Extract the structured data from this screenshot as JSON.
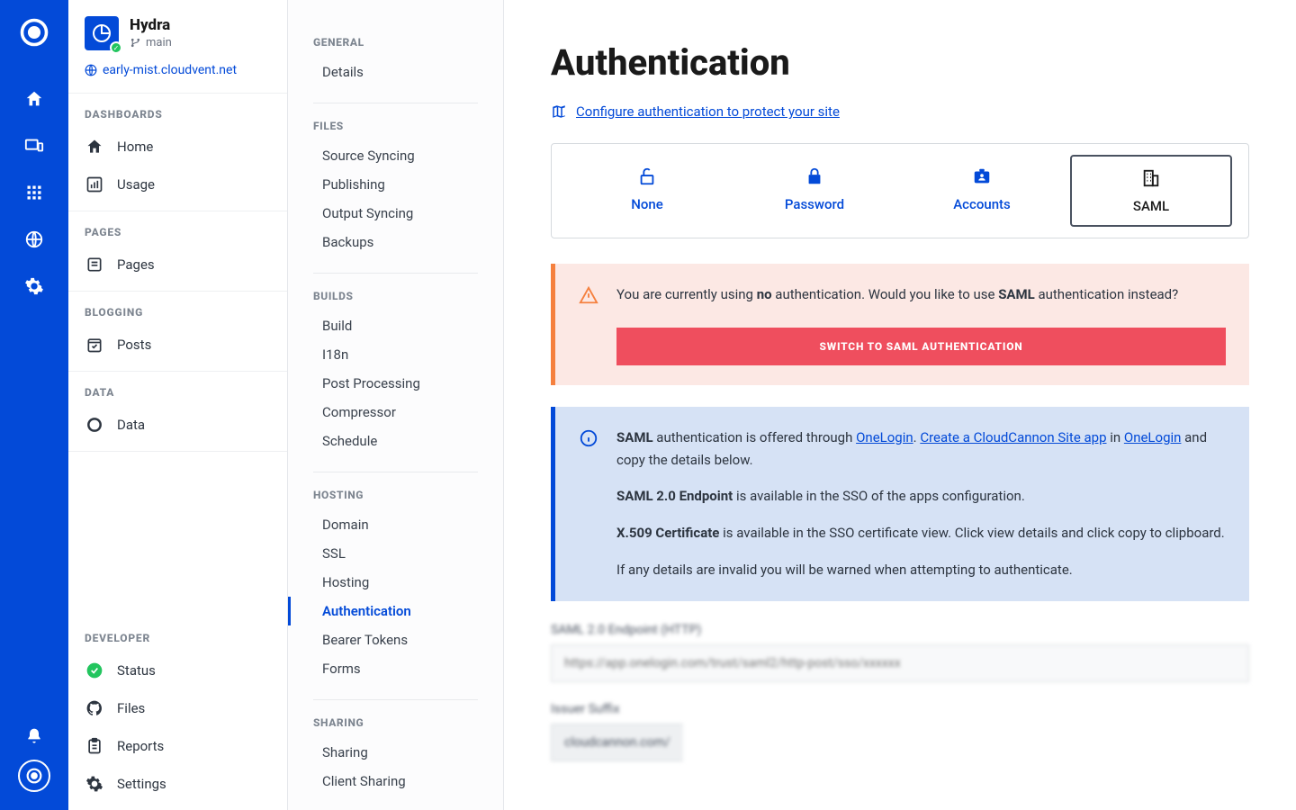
{
  "site": {
    "name": "Hydra",
    "branch": "main",
    "url": "early-mist.cloudvent.net"
  },
  "sidebar": {
    "sections": [
      {
        "heading": "DASHBOARDS",
        "items": [
          {
            "label": "Home"
          },
          {
            "label": "Usage"
          }
        ]
      },
      {
        "heading": "PAGES",
        "items": [
          {
            "label": "Pages"
          }
        ]
      },
      {
        "heading": "BLOGGING",
        "items": [
          {
            "label": "Posts"
          }
        ]
      },
      {
        "heading": "DATA",
        "items": [
          {
            "label": "Data"
          }
        ]
      }
    ],
    "dev": {
      "heading": "DEVELOPER",
      "items": [
        {
          "label": "Status"
        },
        {
          "label": "Files"
        },
        {
          "label": "Reports"
        },
        {
          "label": "Settings"
        }
      ]
    }
  },
  "settings_nav": {
    "groups": [
      {
        "heading": "GENERAL",
        "items": [
          "Details"
        ]
      },
      {
        "heading": "FILES",
        "items": [
          "Source Syncing",
          "Publishing",
          "Output Syncing",
          "Backups"
        ]
      },
      {
        "heading": "BUILDS",
        "items": [
          "Build",
          "I18n",
          "Post Processing",
          "Compressor",
          "Schedule"
        ]
      },
      {
        "heading": "HOSTING",
        "items": [
          "Domain",
          "SSL",
          "Hosting",
          "Authentication",
          "Bearer Tokens",
          "Forms"
        ]
      },
      {
        "heading": "SHARING",
        "items": [
          "Sharing",
          "Client Sharing"
        ]
      }
    ],
    "active": "Authentication"
  },
  "main": {
    "title": "Authentication",
    "doc_link": "Configure authentication to protect your site",
    "tabs": [
      {
        "label": "None"
      },
      {
        "label": "Password"
      },
      {
        "label": "Accounts"
      },
      {
        "label": "SAML"
      }
    ],
    "active_tab": "SAML",
    "warn": {
      "text_pre": "You are currently using ",
      "text_bold1": "no",
      "text_mid": " authentication. Would you like to use ",
      "text_bold2": "SAML",
      "text_post": " authentication instead?",
      "button": "SWITCH TO SAML AUTHENTICATION"
    },
    "info": {
      "p1_bold": "SAML",
      "p1_a": " authentication is offered through ",
      "p1_link1": "OneLogin",
      "p1_b": ". ",
      "p1_link2": "Create a CloudCannon Site app",
      "p1_c": " in ",
      "p1_link3": "OneLogin",
      "p1_d": " and copy the details below.",
      "p2_bold": "SAML 2.0 Endpoint",
      "p2_rest": " is available in the SSO of the apps configuration.",
      "p3_bold": "X.509 Certificate",
      "p3_rest": " is available in the SSO certificate view. Click view details and click copy to clipboard.",
      "p4": "If any details are invalid you will be warned when attempting to authenticate."
    },
    "fields": {
      "endpoint_label": "SAML 2.0 Endpoint (HTTP)",
      "endpoint_placeholder": "https://app.onelogin.com/trust/saml2/http-post/sso/xxxxxx",
      "issuer_label": "Issuer Suffix",
      "issuer_prefix": "cloudcannon.com/"
    }
  }
}
